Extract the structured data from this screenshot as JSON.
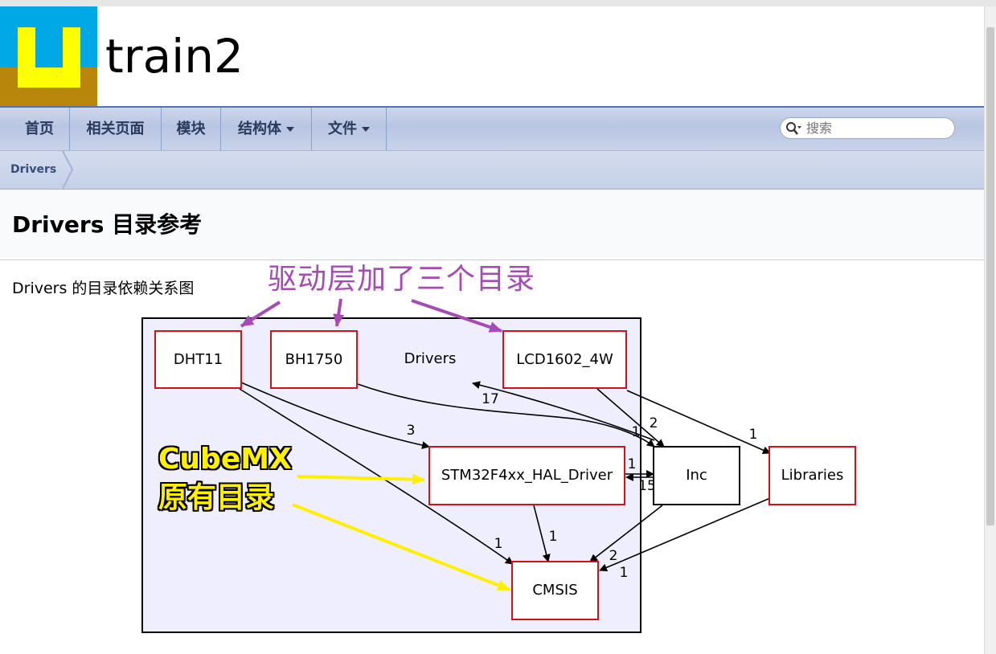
{
  "header": {
    "project_name": "train2"
  },
  "navbar": {
    "items": [
      {
        "label": "首页"
      },
      {
        "label": "相关页面"
      },
      {
        "label": "模块"
      },
      {
        "label": "结构体"
      },
      {
        "label": "文件"
      }
    ],
    "search_placeholder": "搜索"
  },
  "breadcrumb": {
    "items": [
      "Drivers"
    ]
  },
  "page": {
    "title": "Drivers 目录参考",
    "description": "Drivers 的目录依赖关系图"
  },
  "graph": {
    "cluster_label": "Drivers",
    "nodes": {
      "dht11": "DHT11",
      "bh1750": "BH1750",
      "lcd": "LCD1602_4W",
      "hal": "STM32F4xx_HAL_Driver",
      "inc": "Inc",
      "libraries": "Libraries",
      "cmsis": "CMSIS"
    },
    "edge_labels": {
      "dht11_hal": "3",
      "dht11_cmsis": "1",
      "inc_drivers": "17",
      "bh1750_inc": "1",
      "lcd_inc": "2",
      "lcd_libraries": "1",
      "hal_inc": "1",
      "inc_hal": "15",
      "hal_cmsis": "1",
      "inc_cmsis": "2",
      "libraries_cmsis": "1"
    }
  },
  "annotations": {
    "purple_note": "驱动层加了三个目录",
    "yellow_note_line1": "CubeMX",
    "yellow_note_line2": "原有目录"
  },
  "colors": {
    "navbar_text": "#283a5d",
    "node_border": "#d0121a",
    "cluster_fill": "#eeeeff",
    "purple_annotation": "#a64bb5",
    "yellow_annotation": "#fff000"
  }
}
